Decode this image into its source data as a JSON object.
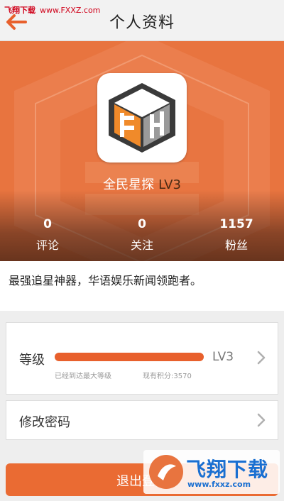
{
  "watermark": {
    "cn": "飞翔下载",
    "url": "www.FXXZ.com",
    "brand": "飞翔下载",
    "site": "www.fxxz.com"
  },
  "header": {
    "title": "个人资料"
  },
  "profile": {
    "name": "全民星探",
    "level": "LV3"
  },
  "stats": [
    {
      "value": "0",
      "label": "评论"
    },
    {
      "value": "0",
      "label": "关注"
    },
    {
      "value": "1157",
      "label": "粉丝"
    }
  ],
  "intro": "最强追星神器，华语娱乐新闻领跑者。",
  "level_card": {
    "label": "等级",
    "value": "LV3",
    "progress": 1.0,
    "hint_left": "已经到达最大等级",
    "hint_right": "现有积分:3570"
  },
  "password_card": {
    "label": "修改密码"
  },
  "logout": {
    "label": "退出登录"
  },
  "colors": {
    "accent": "#e8602c",
    "banner": "#e8743f",
    "level_text": "#4a2a14"
  }
}
